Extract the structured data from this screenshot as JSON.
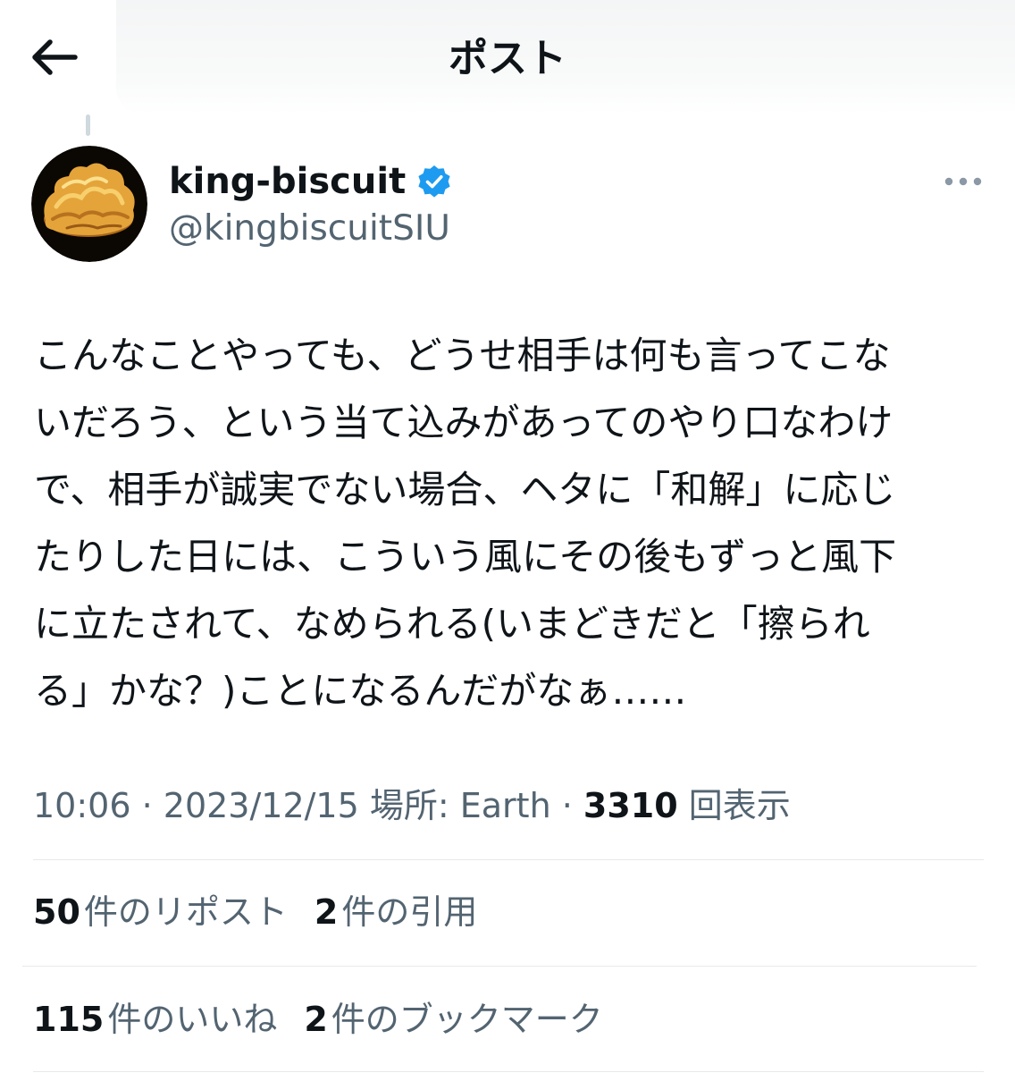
{
  "header": {
    "title": "ポスト",
    "back_icon": "arrow-left-icon"
  },
  "author": {
    "name": "king-biscuit",
    "handle": "@kingbiscuitSIU",
    "verified": true,
    "verified_color": "#1d9bf0",
    "avatar_icon": "biscuit-avatar"
  },
  "post": {
    "lines": [
      "こんなことやっても、どうせ相手は何も言ってこな",
      "いだろう、という当て込みがあってのやり口なわけ",
      "で、相手が誠実でない場合、ヘタに「和解」に応じ",
      "たりした日には、こういう風にその後もずっと風下",
      "に立たされて、なめられる(いまどきだと「擦られ",
      "る」かな？)ことになるんだがなぁ……"
    ]
  },
  "meta": {
    "time": "10:06",
    "sep1": " · ",
    "date": "2023/12/15",
    "location": " 場所: Earth",
    "sep2": " · ",
    "views_count": "3310",
    "views_label": " 回表示"
  },
  "stats": {
    "reposts_count": "50",
    "reposts_label": "件のリポスト",
    "quotes_count": "2",
    "quotes_label": "件の引用",
    "likes_count": "115",
    "likes_label": "件のいいね",
    "bookmarks_count": "2",
    "bookmarks_label": "件のブックマーク"
  },
  "colors": {
    "text_primary": "#0f1419",
    "text_secondary": "#536471",
    "accent": "#1d9bf0",
    "divider": "#e6e9ea"
  }
}
